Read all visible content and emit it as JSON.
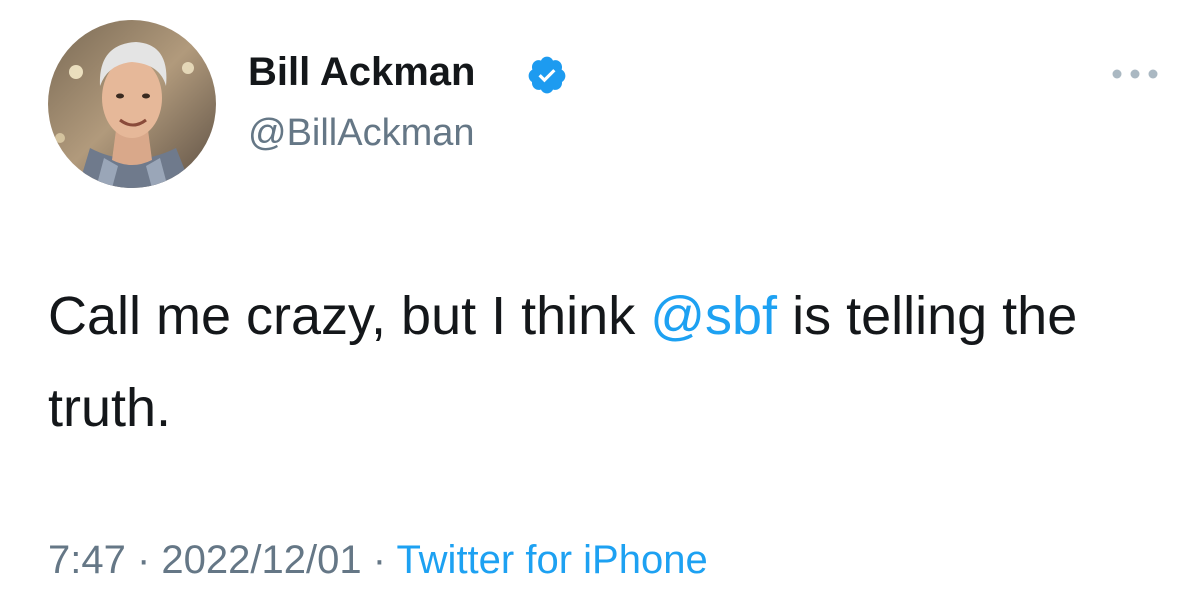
{
  "author": {
    "display_name": "Bill Ackman",
    "handle": "@BillAckman",
    "verified": true,
    "avatar_icon": "avatar-photo"
  },
  "tweet": {
    "text_part1": "Call me crazy, but I think ",
    "mention": "@sbf",
    "text_part2": " is telling the truth."
  },
  "meta": {
    "time": "7:47",
    "separator": " · ",
    "date": "2022/12/01",
    "source": "Twitter for iPhone"
  },
  "icons": {
    "verified": "verified-badge-icon",
    "more": "more-options-icon"
  },
  "colors": {
    "link": "#1da1f2",
    "secondary_text": "#657786",
    "primary_text": "#14171a",
    "verified": "#1d9bf0"
  }
}
